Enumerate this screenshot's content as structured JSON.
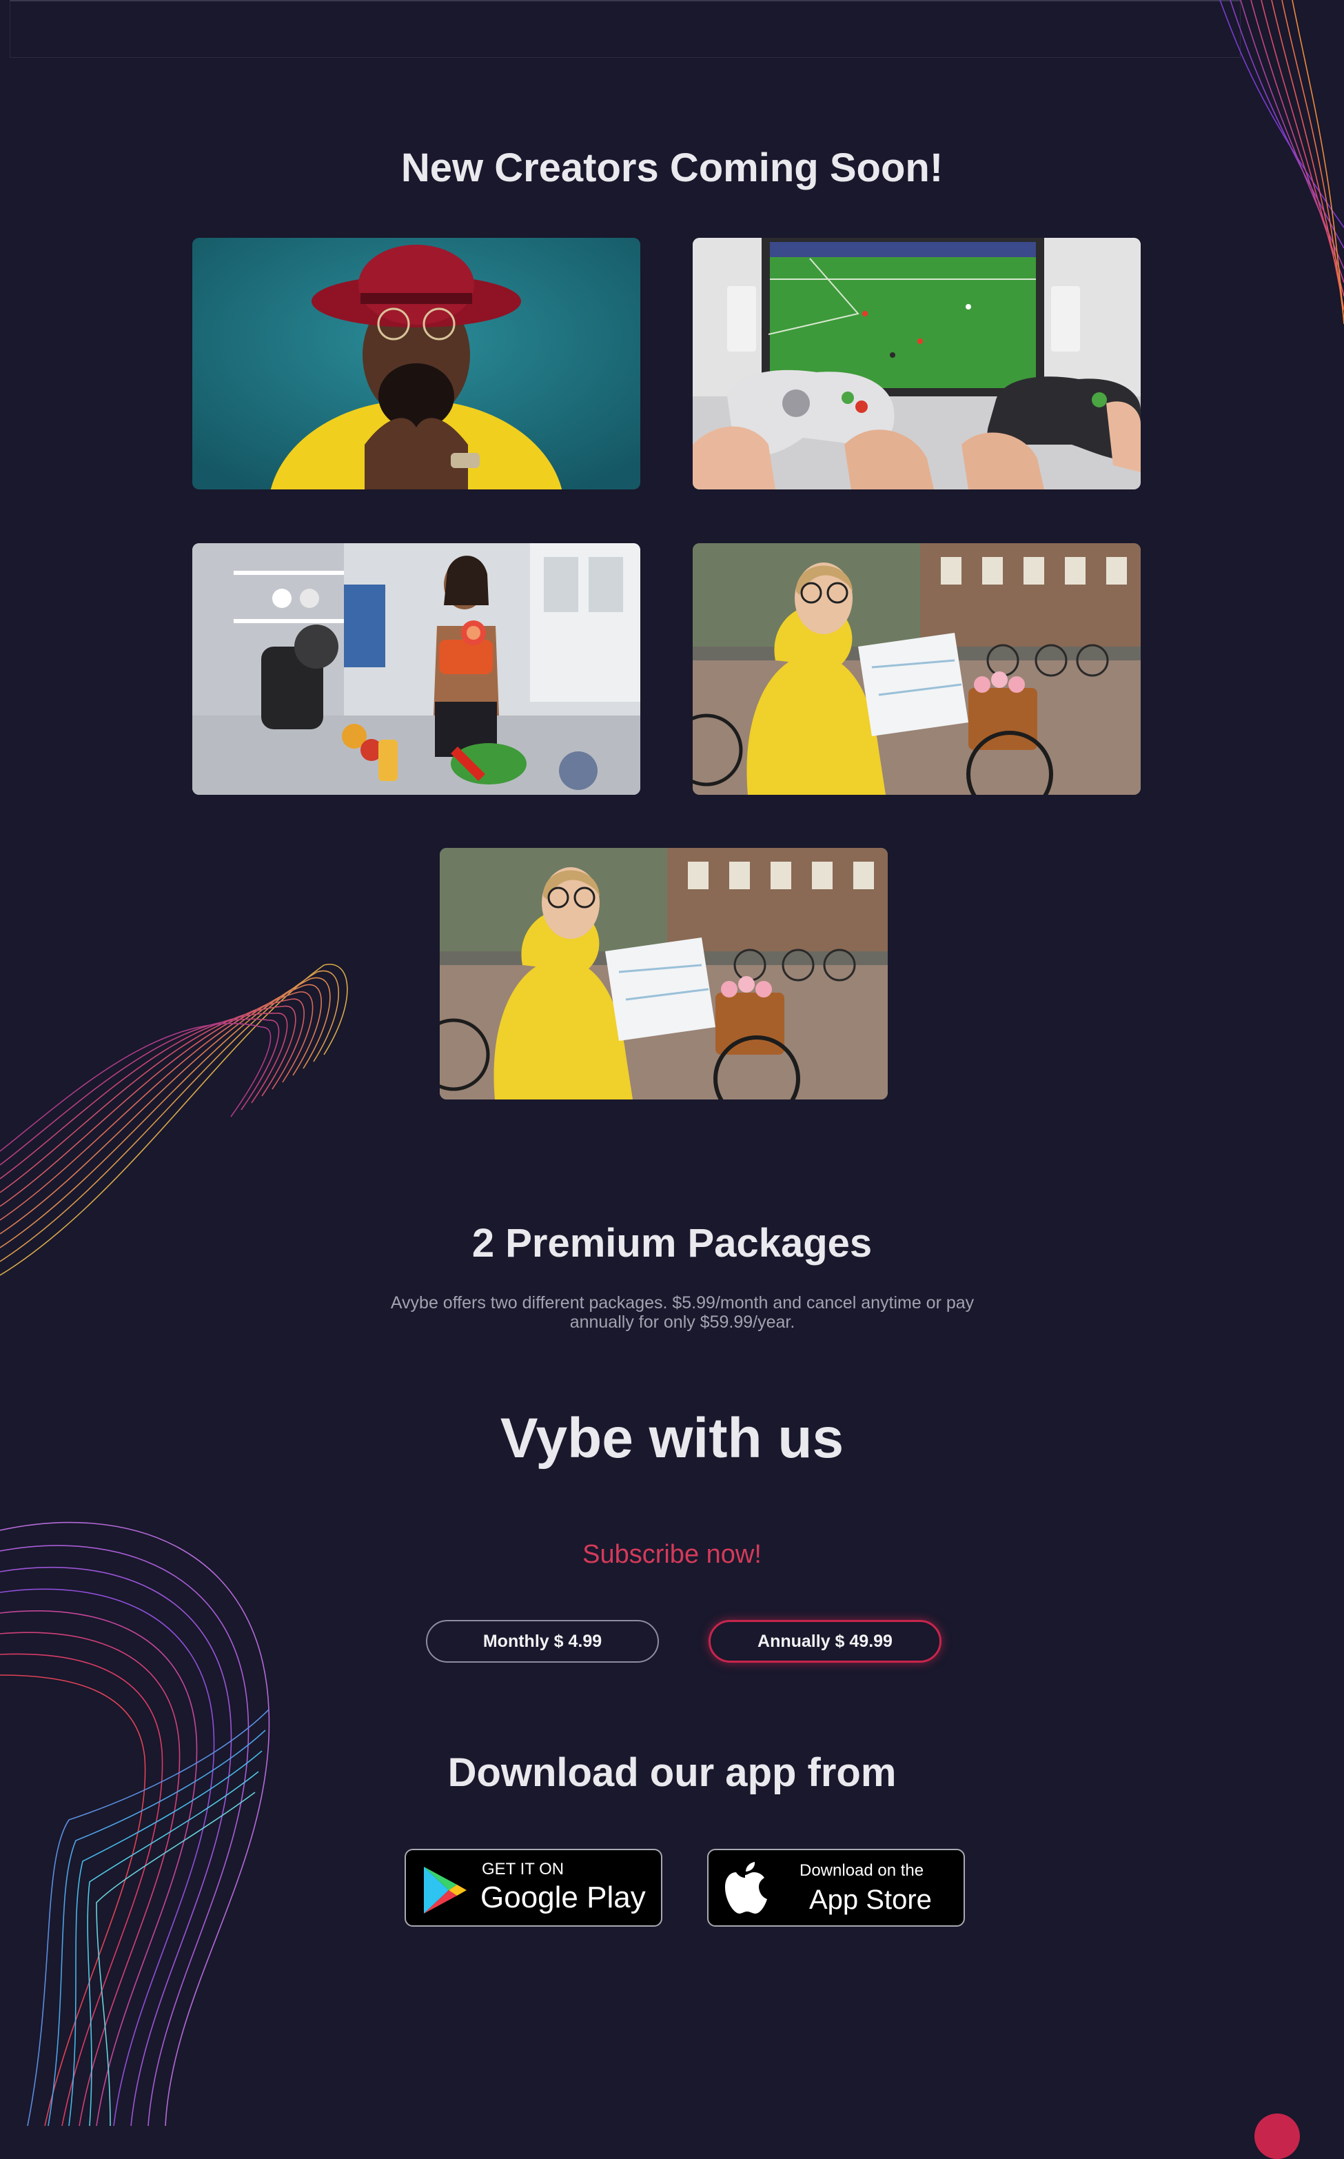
{
  "sections": {
    "creators_title": "New Creators Coming Soon!",
    "creator_cards": [
      {
        "subject": "Man in red hat and yellow sweater"
      },
      {
        "subject": "Two players with game controllers watching soccer"
      },
      {
        "subject": "Woman filming a cooking video in kitchen"
      },
      {
        "subject": "Woman in yellow jacket with map and bicycle"
      },
      {
        "subject": "Woman in yellow jacket with map and bicycle"
      }
    ],
    "packages_title": "2 Premium Packages",
    "packages_desc": "Avybe offers two different packages. $5.99/month and cancel anytime or pay annually for only $59.99/year.",
    "vybe_title": "Vybe with us",
    "subscribe_label": "Subscribe now!",
    "plans": {
      "monthly": "Monthly $ 4.99",
      "annual": "Annually $ 49.99"
    },
    "download_title": "Download our app from",
    "google_play": {
      "top": "GET IT ON",
      "bottom": "Google Play"
    },
    "app_store": {
      "top": "Download on the",
      "bottom": "App Store"
    }
  },
  "colors": {
    "background": "#19182c",
    "accent": "#d53a5a",
    "text": "#ececf2"
  },
  "icons": [
    "google-play-icon",
    "apple-icon"
  ]
}
